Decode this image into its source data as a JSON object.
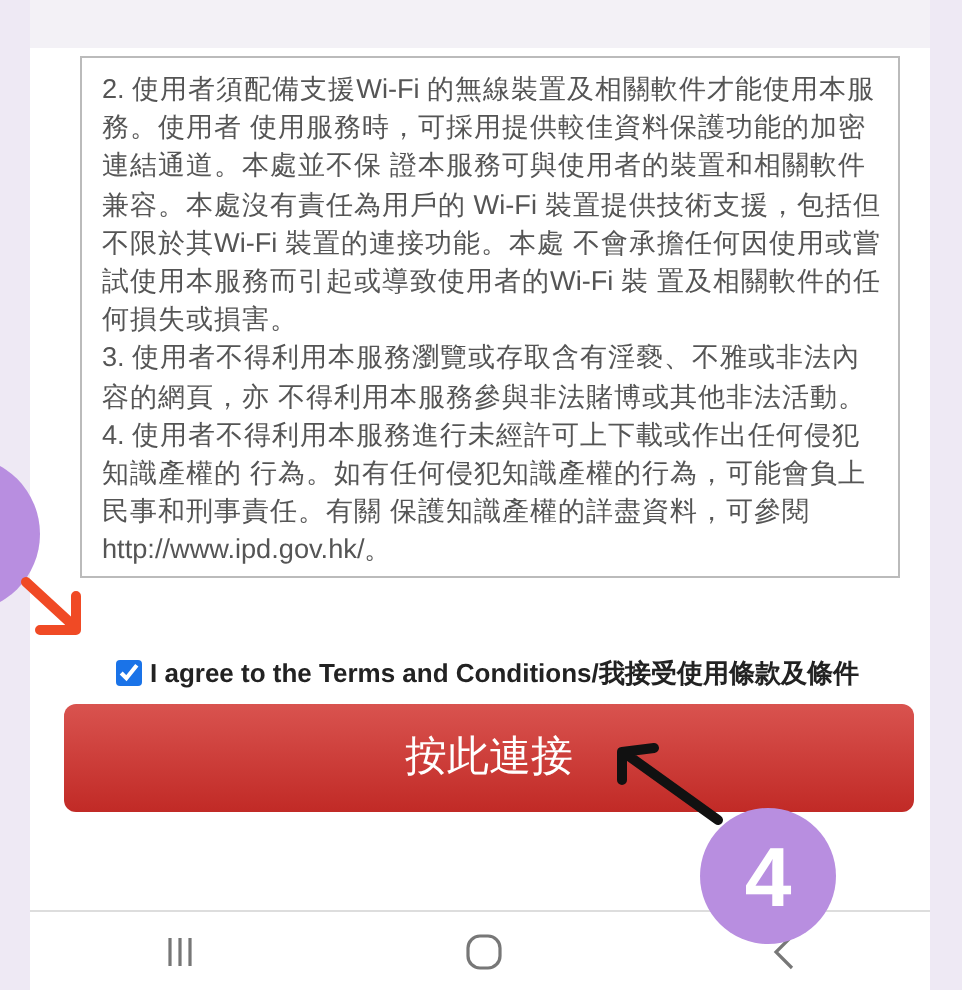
{
  "terms": {
    "paragraphs": [
      "2. 使用者須配備支援Wi-Fi 的無線裝置及相關軟件才能使用本服務。使用者 使用服務時，可採用提供較佳資料保護功能的加密連結通道。本處並不保 證本服務可與使用者的裝置和相關軟件兼容。本處沒有責任為用戶的 Wi-Fi 裝置提供技術支援，包括但不限於其Wi-Fi 裝置的連接功能。本處 不會承擔任何因使用或嘗試使用本服務而引起或導致使用者的Wi-Fi 裝 置及相關軟件的任何損失或損害。",
      "3. 使用者不得利用本服務瀏覽或存取含有淫褻、不雅或非法內容的網頁，亦 不得利用本服務參與非法賭博或其他非法活動。",
      "4. 使用者不得利用本服務進行未經許可上下載或作出任何侵犯知識產權的 行為。如有任何侵犯知識產權的行為，可能會負上民事和刑事責任。有關 保護知識產權的詳盡資料，可參閱http://www.ipd.gov.hk/。"
    ]
  },
  "agree": {
    "label": "I agree to the Terms and Conditions/我接受使用條款及條件",
    "checked": true
  },
  "connect_button": "按此連接",
  "step_badge": "4"
}
